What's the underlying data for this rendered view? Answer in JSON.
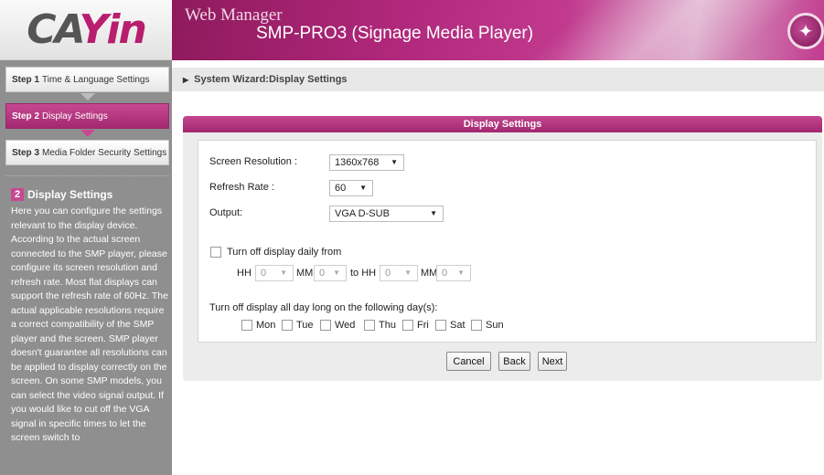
{
  "logo": {
    "prefix": "CA",
    "suffix": "Yin"
  },
  "banner": {
    "title": "Web Manager",
    "model": "SMP-PRO3 (Signage Media Player)"
  },
  "steps": [
    {
      "num": "Step 1",
      "label": "Time & Language Settings"
    },
    {
      "num": "Step 2",
      "label": "Display Settings"
    },
    {
      "num": "Step 3",
      "label": "Media Folder Security Settings"
    }
  ],
  "help": {
    "num": "2",
    "title": "Display Settings",
    "text": "Here you can configure the settings relevant to the display device. According to the actual screen connected to the SMP player, please configure its screen resolution and refresh rate. Most flat displays can support the refresh rate of 60Hz. The actual applicable resolutions require a correct compatibility of the SMP player and the screen. SMP player doesn't guarantee all resolutions can be applied to display correctly on the screen. On some SMP models, you can select the video signal output. If you would like to cut off the VGA signal in specific times to let the screen switch to"
  },
  "breadcrumb": "System Wizard:Display Settings",
  "panel": {
    "title": "Display Settings"
  },
  "form": {
    "resolution_label": "Screen Resolution :",
    "resolution_value": "1360x768",
    "refresh_label": "Refresh Rate :",
    "refresh_value": "60",
    "output_label": "Output:",
    "output_value": "VGA D-SUB",
    "daily_label": "Turn off display daily from",
    "hh1_label": "HH",
    "hh1_value": "0",
    "mm1_label": "MM",
    "mm1_value": "0",
    "to_label": "to HH",
    "hh2_value": "0",
    "mm2_label": "MM",
    "mm2_value": "0",
    "days_label": "Turn off display all day long on the following day(s):",
    "days": [
      "Mon",
      "Tue",
      "Wed",
      "Thu",
      "Fri",
      "Sat",
      "Sun"
    ]
  },
  "buttons": {
    "cancel": "Cancel",
    "back": "Back",
    "next": "Next"
  }
}
